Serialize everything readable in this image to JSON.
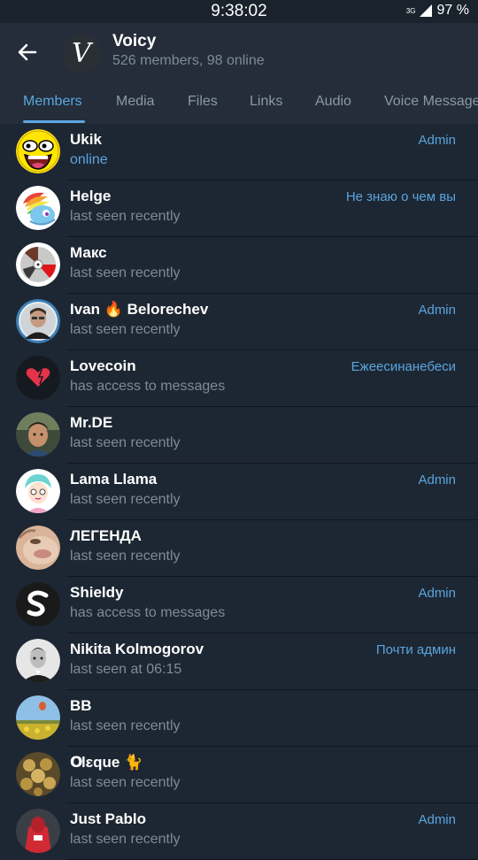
{
  "status_bar": {
    "time": "9:38:02",
    "network": "3G",
    "battery": "97 %"
  },
  "header": {
    "title": "Voicy",
    "subtitle": "526 members, 98 online",
    "avatar_letter": "V",
    "back_icon": "arrow-left-icon"
  },
  "tabs": [
    {
      "label": "Members",
      "active": true
    },
    {
      "label": "Media"
    },
    {
      "label": "Files"
    },
    {
      "label": "Links"
    },
    {
      "label": "Audio"
    },
    {
      "label": "Voice Message"
    }
  ],
  "members": [
    {
      "name": "Ukik",
      "status": "online",
      "role": "Admin",
      "online": true
    },
    {
      "name": "Helge",
      "status": "last seen recently",
      "role": "Не знаю о чем вы"
    },
    {
      "name": "Макс",
      "status": "last seen recently",
      "role": ""
    },
    {
      "name": "Ivan 🔥 Belorechev",
      "status": "last seen recently",
      "role": "Admin"
    },
    {
      "name": "Lovecoin",
      "status": "has access to messages",
      "role": "Ежеесинанебеси"
    },
    {
      "name": "Mr.DE",
      "status": "last seen recently",
      "role": ""
    },
    {
      "name": "Lama Llama",
      "status": "last seen recently",
      "role": "Admin"
    },
    {
      "name": "ЛЕГЕНДА",
      "status": "last seen recently",
      "role": ""
    },
    {
      "name": "Shieldy",
      "status": "has access to messages",
      "role": "Admin"
    },
    {
      "name": "Nikita Kolmogorov",
      "status": "last seen at 06:15",
      "role": "Почти админ"
    },
    {
      "name": "BB",
      "status": "last seen recently",
      "role": ""
    },
    {
      "name": "Օlɛque 🐈",
      "status": "last seen recently",
      "role": ""
    },
    {
      "name": "Just Pablo",
      "status": "last seen recently",
      "role": "Admin"
    }
  ],
  "colors": {
    "accent": "#5aa5df",
    "background": "#1d2733",
    "header": "#242d39",
    "muted": "#7d8b99"
  }
}
